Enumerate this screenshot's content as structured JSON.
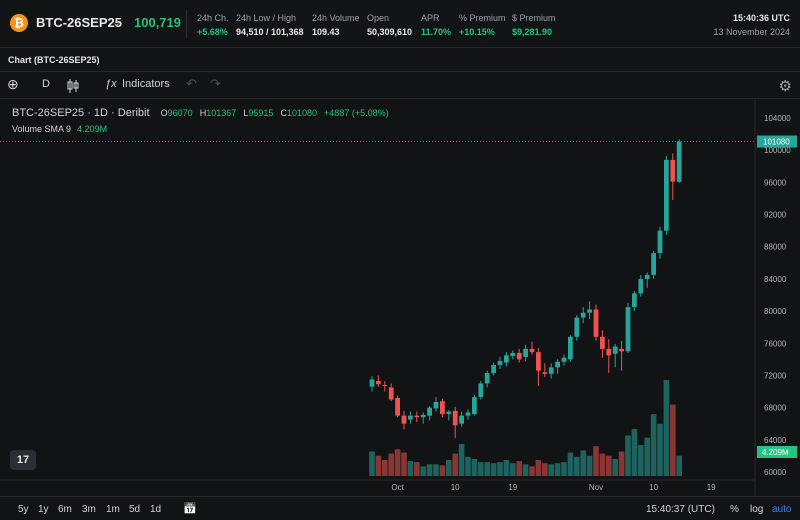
{
  "header": {
    "coin_glyph": "₿",
    "instrument": "BTC-26SEP25",
    "chevron": "⌄",
    "last_price": "100,719",
    "stats": [
      {
        "label": "24h Ch.",
        "value": "+5.68%",
        "tone": "green"
      },
      {
        "label": "24h Low / High",
        "value": "94,510 / 101,368",
        "tone": "white"
      },
      {
        "label": "24h Volume",
        "value": "109.43",
        "tone": "white"
      },
      {
        "label": "Open",
        "value": "50,309,610",
        "tone": "white"
      },
      {
        "label": "APR",
        "value": "11.70%",
        "tone": "green"
      },
      {
        "label": "% Premium",
        "value": "+10.15%",
        "tone": "green"
      },
      {
        "label": "$ Premium",
        "value": "$9,281.90",
        "tone": "green"
      }
    ],
    "time": "15:40:36 UTC",
    "date": "13 November 2024"
  },
  "chart_title": "Chart (BTC-26SEP25)",
  "toolbar": {
    "add_icon": "⊕",
    "interval": "D",
    "fx_icon": "ƒx",
    "indicators": "Indicators",
    "undo_icon": "↶",
    "redo_icon": "↷",
    "settings_icon": "⚙"
  },
  "legend": {
    "symbol": "BTC-26SEP25 · 1D · Deribit",
    "o_label": "O",
    "o_value": "96070",
    "h_label": "H",
    "h_value": "101367",
    "l_label": "L",
    "l_value": "95915",
    "c_label": "C",
    "c_value": "101080",
    "change": "+4887 (+5.08%)",
    "volume_label": "Volume SMA 9",
    "volume_value": "4.209M"
  },
  "tv_logo": "17",
  "bottombar": {
    "ranges": [
      "5y",
      "1y",
      "6m",
      "3m",
      "1m",
      "5d",
      "1d"
    ],
    "calendar_icon": "📅",
    "time": "15:40:37 (UTC)",
    "percent": "%",
    "log": "log",
    "auto": "auto"
  },
  "colors": {
    "up": "#26a69a",
    "down": "#ef5350",
    "accent_green": "#26c281",
    "background": "#121314"
  },
  "chart_data": {
    "type": "candlestick",
    "y_ticks": [
      104000,
      100000,
      96000,
      92000,
      88000,
      84000,
      80000,
      76000,
      72000,
      68000,
      64000,
      60000
    ],
    "y_tick_labels": [
      "104000",
      "100000",
      "96000",
      "92000",
      "88000",
      "84000",
      "80000",
      "76000",
      "72000",
      "68000",
      "64000",
      "60000"
    ],
    "ylim": [
      59000,
      105000
    ],
    "x_tick_labels": [
      {
        "label": "Oct",
        "index": 4
      },
      {
        "label": "10",
        "index": 13
      },
      {
        "label": "19",
        "index": 22
      },
      {
        "label": "Nov",
        "index": 35
      },
      {
        "label": "10",
        "index": 44
      },
      {
        "label": "19",
        "index": 53
      }
    ],
    "x_index_range": [
      -1,
      58
    ],
    "last_price_label": "101080",
    "last_price_value": 101080,
    "volume_sma_label": "4.209M",
    "volume_sma_value": 4.209,
    "volume_max": 9.0,
    "candles": [
      {
        "o": 70600,
        "h": 71900,
        "l": 70000,
        "c": 71500
      },
      {
        "o": 71300,
        "h": 72000,
        "l": 70600,
        "c": 70900
      },
      {
        "o": 70800,
        "h": 71300,
        "l": 70000,
        "c": 70700
      },
      {
        "o": 70500,
        "h": 71000,
        "l": 68800,
        "c": 69000
      },
      {
        "o": 69200,
        "h": 69500,
        "l": 66800,
        "c": 67000
      },
      {
        "o": 67000,
        "h": 67600,
        "l": 65300,
        "c": 66000
      },
      {
        "o": 66500,
        "h": 67500,
        "l": 66000,
        "c": 67000
      },
      {
        "o": 67000,
        "h": 67500,
        "l": 66200,
        "c": 66800
      },
      {
        "o": 66800,
        "h": 67400,
        "l": 66000,
        "c": 67100
      },
      {
        "o": 67000,
        "h": 68200,
        "l": 66400,
        "c": 68000
      },
      {
        "o": 67900,
        "h": 69300,
        "l": 67500,
        "c": 68700
      },
      {
        "o": 68800,
        "h": 69100,
        "l": 66800,
        "c": 67200
      },
      {
        "o": 67200,
        "h": 67700,
        "l": 66400,
        "c": 67500
      },
      {
        "o": 67600,
        "h": 68100,
        "l": 64200,
        "c": 65800
      },
      {
        "o": 66000,
        "h": 67500,
        "l": 65600,
        "c": 67000
      },
      {
        "o": 67000,
        "h": 67800,
        "l": 66500,
        "c": 67400
      },
      {
        "o": 67200,
        "h": 69600,
        "l": 67000,
        "c": 69300
      },
      {
        "o": 69300,
        "h": 71300,
        "l": 69000,
        "c": 71000
      },
      {
        "o": 71000,
        "h": 72600,
        "l": 70500,
        "c": 72300
      },
      {
        "o": 72300,
        "h": 73600,
        "l": 72000,
        "c": 73300
      },
      {
        "o": 73300,
        "h": 74300,
        "l": 72800,
        "c": 73800
      },
      {
        "o": 73600,
        "h": 74900,
        "l": 73100,
        "c": 74500
      },
      {
        "o": 74400,
        "h": 75100,
        "l": 74000,
        "c": 74800
      },
      {
        "o": 74800,
        "h": 75300,
        "l": 73600,
        "c": 74000
      },
      {
        "o": 74300,
        "h": 75800,
        "l": 73800,
        "c": 75300
      },
      {
        "o": 75300,
        "h": 76200,
        "l": 74600,
        "c": 74900
      },
      {
        "o": 74900,
        "h": 75400,
        "l": 70700,
        "c": 72600
      },
      {
        "o": 72400,
        "h": 73500,
        "l": 71800,
        "c": 72200
      },
      {
        "o": 72200,
        "h": 73500,
        "l": 71600,
        "c": 73000
      },
      {
        "o": 73000,
        "h": 74000,
        "l": 72200,
        "c": 73700
      },
      {
        "o": 73700,
        "h": 74600,
        "l": 73200,
        "c": 74200
      },
      {
        "o": 74000,
        "h": 77000,
        "l": 73700,
        "c": 76800
      },
      {
        "o": 76800,
        "h": 79500,
        "l": 76300,
        "c": 79200
      },
      {
        "o": 79200,
        "h": 80500,
        "l": 78500,
        "c": 79800
      },
      {
        "o": 79800,
        "h": 81200,
        "l": 79000,
        "c": 80200
      },
      {
        "o": 80200,
        "h": 80800,
        "l": 76300,
        "c": 76800
      },
      {
        "o": 76800,
        "h": 77600,
        "l": 74200,
        "c": 75300
      },
      {
        "o": 75300,
        "h": 76500,
        "l": 72300,
        "c": 74500
      },
      {
        "o": 74700,
        "h": 75900,
        "l": 73000,
        "c": 75600
      },
      {
        "o": 75300,
        "h": 76300,
        "l": 72600,
        "c": 75000
      },
      {
        "o": 75000,
        "h": 81000,
        "l": 74800,
        "c": 80500
      },
      {
        "o": 80500,
        "h": 82500,
        "l": 80000,
        "c": 82200
      },
      {
        "o": 82200,
        "h": 84500,
        "l": 81800,
        "c": 84000
      },
      {
        "o": 84000,
        "h": 84800,
        "l": 82900,
        "c": 84500
      },
      {
        "o": 84500,
        "h": 87500,
        "l": 84000,
        "c": 87200
      },
      {
        "o": 87200,
        "h": 90500,
        "l": 86500,
        "c": 90000
      },
      {
        "o": 90000,
        "h": 99300,
        "l": 89500,
        "c": 98800
      },
      {
        "o": 98800,
        "h": 99600,
        "l": 93800,
        "c": 96100
      },
      {
        "o": 96070,
        "h": 101367,
        "l": 95915,
        "c": 101080
      }
    ],
    "volume": [
      2.3,
      1.9,
      1.5,
      2.1,
      2.5,
      2.2,
      1.4,
      1.3,
      0.9,
      1.1,
      1.1,
      1.0,
      1.5,
      2.1,
      3.0,
      1.8,
      1.6,
      1.3,
      1.3,
      1.2,
      1.3,
      1.5,
      1.2,
      1.4,
      1.1,
      0.9,
      1.5,
      1.2,
      1.1,
      1.2,
      1.3,
      2.2,
      1.8,
      2.4,
      1.9,
      2.8,
      2.1,
      1.9,
      1.6,
      2.3,
      3.8,
      4.4,
      2.9,
      3.6,
      5.8,
      4.9,
      9.0,
      6.7,
      1.9
    ]
  }
}
